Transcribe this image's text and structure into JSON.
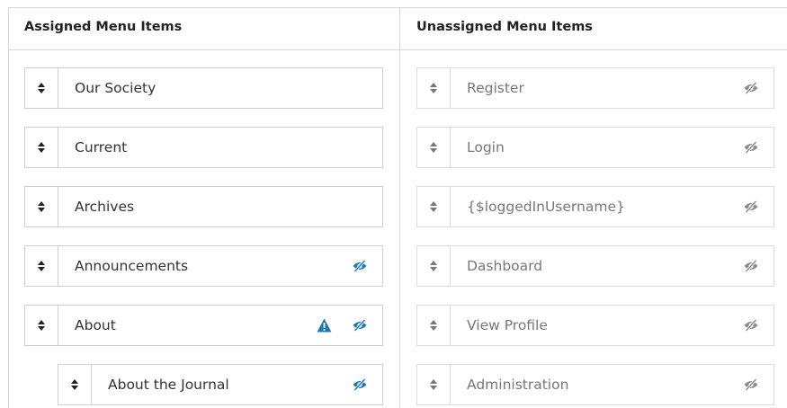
{
  "assigned": {
    "title": "Assigned Menu Items",
    "items": [
      {
        "label": "Our Society"
      },
      {
        "label": "Current"
      },
      {
        "label": "Archives"
      },
      {
        "label": "Announcements"
      },
      {
        "label": "About"
      },
      {
        "label": "About the Journal"
      }
    ]
  },
  "unassigned": {
    "title": "Unassigned Menu Items",
    "items": [
      {
        "label": "Register"
      },
      {
        "label": "Login"
      },
      {
        "label": "{$loggedInUsername}"
      },
      {
        "label": "Dashboard"
      },
      {
        "label": "View Profile"
      },
      {
        "label": "Administration"
      }
    ]
  },
  "colors": {
    "accent": "#1a7ab8",
    "muted_icon": "#8a8a8a"
  }
}
